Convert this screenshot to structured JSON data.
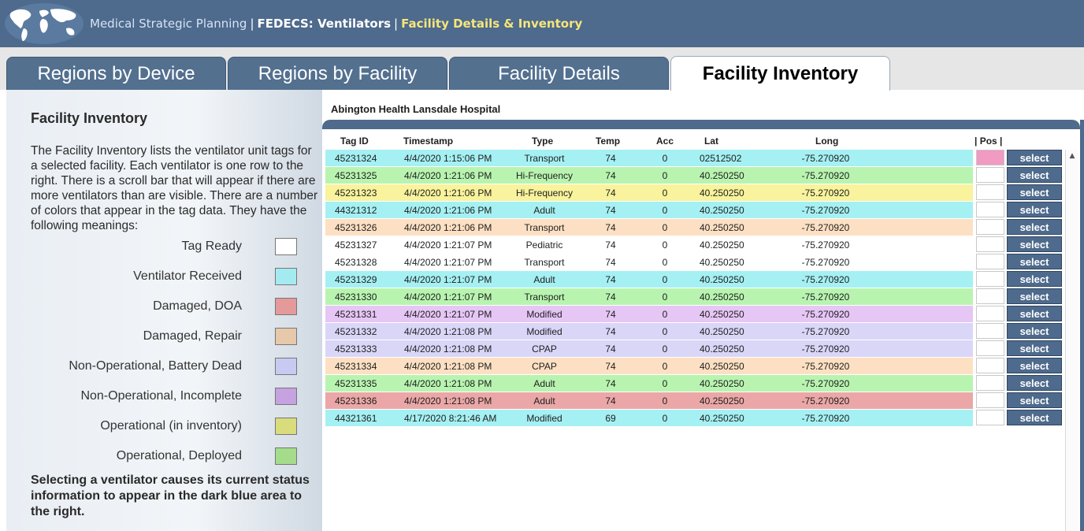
{
  "header": {
    "app_title": "Medical Strategic Planning",
    "separator": "|",
    "section": "FEDECS: Ventilators",
    "page": "Facility Details & Inventory"
  },
  "tabs": [
    {
      "label": "Regions by Device",
      "active": false
    },
    {
      "label": "Regions by Facility",
      "active": false
    },
    {
      "label": "Facility Details",
      "active": false
    },
    {
      "label": "Facility Inventory",
      "active": true
    }
  ],
  "left_panel": {
    "title": "Facility Inventory",
    "description": "The Facility Inventory lists the ventilator unit tags for a selected facility. Each ventilator is one row to the right. There is a scroll bar that will appear if there are more ventilators than are visible. There are a number of colors that appear in the tag data. They have the following meanings:",
    "legend": [
      {
        "label": "Tag Ready",
        "color": "#ffffff"
      },
      {
        "label": "Ventilator Received",
        "color": "#a4ebf1"
      },
      {
        "label": "Damaged, DOA",
        "color": "#e49a9a"
      },
      {
        "label": "Damaged, Repair",
        "color": "#e7c8aa"
      },
      {
        "label": "Non-Operational, Battery Dead",
        "color": "#c9caf2"
      },
      {
        "label": "Non-Operational, Incomplete",
        "color": "#c6a2e0"
      },
      {
        "label": "Operational (in inventory)",
        "color": "#d9dc7a"
      },
      {
        "label": "Operational, Deployed",
        "color": "#a4dc8c"
      }
    ],
    "note": "Selecting a ventilator causes its current status information to appear in the dark blue area to the right."
  },
  "facility_name": "Abington Health Lansdale Hospital",
  "table": {
    "headers": {
      "tag_id": "Tag ID",
      "timestamp": "Timestamp",
      "type": "Type",
      "temp": "Temp",
      "acc": "Acc",
      "lat": "Lat",
      "long": "Long",
      "pos": "| Pos  |"
    },
    "select_label": "select",
    "rows": [
      {
        "tag_id": "45231324",
        "timestamp": "4/4/2020 1:15:06 PM",
        "type": "Transport",
        "temp": "74",
        "acc": "0",
        "lat": "02512502",
        "long": "-75.270920",
        "color": "#a5f0f3",
        "pos_color": "#f19ac2"
      },
      {
        "tag_id": "45231325",
        "timestamp": "4/4/2020 1:21:06 PM",
        "type": "Hi-Frequency",
        "temp": "74",
        "acc": "0",
        "lat": "40.250250",
        "long": "-75.270920",
        "color": "#b8f4b0",
        "pos_color": "#ffffff"
      },
      {
        "tag_id": "45231323",
        "timestamp": "4/4/2020 1:21:06 PM",
        "type": "Hi-Frequency",
        "temp": "74",
        "acc": "0",
        "lat": "40.250250",
        "long": "-75.270920",
        "color": "#f8f39c",
        "pos_color": "#ffffff"
      },
      {
        "tag_id": "44321312",
        "timestamp": "4/4/2020 1:21:06 PM",
        "type": "Adult",
        "temp": "74",
        "acc": "0",
        "lat": "40.250250",
        "long": "-75.270920",
        "color": "#a5f0f3",
        "pos_color": "#ffffff"
      },
      {
        "tag_id": "45231326",
        "timestamp": "4/4/2020 1:21:06 PM",
        "type": "Transport",
        "temp": "74",
        "acc": "0",
        "lat": "40.250250",
        "long": "-75.270920",
        "color": "#fde0c3",
        "pos_color": "#ffffff"
      },
      {
        "tag_id": "45231327",
        "timestamp": "4/4/2020 1:21:07 PM",
        "type": "Pediatric",
        "temp": "74",
        "acc": "0",
        "lat": "40.250250",
        "long": "-75.270920",
        "color": "#ffffff",
        "pos_color": "#ffffff"
      },
      {
        "tag_id": "45231328",
        "timestamp": "4/4/2020 1:21:07 PM",
        "type": "Transport",
        "temp": "74",
        "acc": "0",
        "lat": "40.250250",
        "long": "-75.270920",
        "color": "#ffffff",
        "pos_color": "#ffffff"
      },
      {
        "tag_id": "45231329",
        "timestamp": "4/4/2020 1:21:07 PM",
        "type": "Adult",
        "temp": "74",
        "acc": "0",
        "lat": "40.250250",
        "long": "-75.270920",
        "color": "#a5f0f3",
        "pos_color": "#ffffff"
      },
      {
        "tag_id": "45231330",
        "timestamp": "4/4/2020 1:21:07 PM",
        "type": "Transport",
        "temp": "74",
        "acc": "0",
        "lat": "40.250250",
        "long": "-75.270920",
        "color": "#b8f4b0",
        "pos_color": "#ffffff"
      },
      {
        "tag_id": "45231331",
        "timestamp": "4/4/2020 1:21:07 PM",
        "type": "Modified",
        "temp": "74",
        "acc": "0",
        "lat": "40.250250",
        "long": "-75.270920",
        "color": "#e6c6f5",
        "pos_color": "#ffffff"
      },
      {
        "tag_id": "45231332",
        "timestamp": "4/4/2020 1:21:08 PM",
        "type": "Modified",
        "temp": "74",
        "acc": "0",
        "lat": "40.250250",
        "long": "-75.270920",
        "color": "#d9d6f8",
        "pos_color": "#ffffff"
      },
      {
        "tag_id": "45231333",
        "timestamp": "4/4/2020 1:21:08 PM",
        "type": "CPAP",
        "temp": "74",
        "acc": "0",
        "lat": "40.250250",
        "long": "-75.270920",
        "color": "#d9d6f8",
        "pos_color": "#ffffff"
      },
      {
        "tag_id": "45231334",
        "timestamp": "4/4/2020 1:21:08 PM",
        "type": "CPAP",
        "temp": "74",
        "acc": "0",
        "lat": "40.250250",
        "long": "-75.270920",
        "color": "#fde0c3",
        "pos_color": "#ffffff"
      },
      {
        "tag_id": "45231335",
        "timestamp": "4/4/2020 1:21:08 PM",
        "type": "Adult",
        "temp": "74",
        "acc": "0",
        "lat": "40.250250",
        "long": "-75.270920",
        "color": "#b8f4b0",
        "pos_color": "#ffffff"
      },
      {
        "tag_id": "45231336",
        "timestamp": "4/4/2020 1:21:08 PM",
        "type": "Adult",
        "temp": "74",
        "acc": "0",
        "lat": "40.250250",
        "long": "-75.270920",
        "color": "#eba7a7",
        "pos_color": "#ffffff"
      },
      {
        "tag_id": "44321361",
        "timestamp": "4/17/2020 8:21:46 AM",
        "type": "Modified",
        "temp": "69",
        "acc": "0",
        "lat": "40.250250",
        "long": "-75.270920",
        "color": "#a5f0f3",
        "pos_color": "#ffffff"
      }
    ]
  }
}
